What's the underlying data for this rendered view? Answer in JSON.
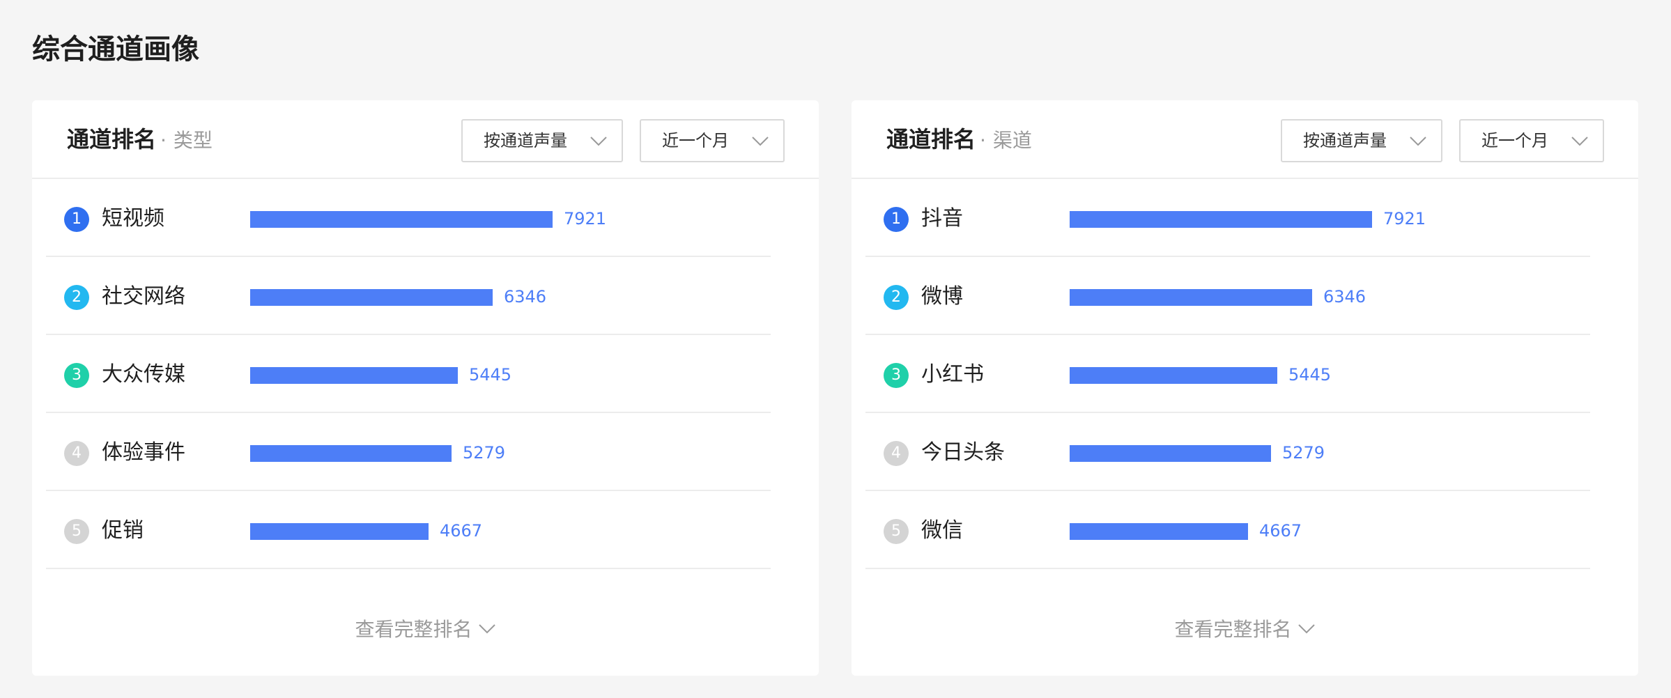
{
  "page_title": "综合通道画像",
  "colors": {
    "bar": "#4d7ef7",
    "rank1": "#2f6ff0",
    "rank2": "#22b8f0",
    "rank3": "#1fd0a9",
    "rank_other": "#d4d4d4"
  },
  "cards": [
    {
      "title": "通道排名",
      "subtitle": "类型",
      "metric_select": "按通道声量",
      "period_select": "近一个月",
      "more_label": "查看完整排名",
      "items": [
        {
          "rank": "1",
          "label": "短视频",
          "value": 7921
        },
        {
          "rank": "2",
          "label": "社交网络",
          "value": 6346
        },
        {
          "rank": "3",
          "label": "大众传媒",
          "value": 5445
        },
        {
          "rank": "4",
          "label": "体验事件",
          "value": 5279
        },
        {
          "rank": "5",
          "label": "促销",
          "value": 4667
        }
      ]
    },
    {
      "title": "通道排名",
      "subtitle": "渠道",
      "metric_select": "按通道声量",
      "period_select": "近一个月",
      "more_label": "查看完整排名",
      "items": [
        {
          "rank": "1",
          "label": "抖音",
          "value": 7921
        },
        {
          "rank": "2",
          "label": "微博",
          "value": 6346
        },
        {
          "rank": "3",
          "label": "小红书",
          "value": 5445
        },
        {
          "rank": "4",
          "label": "今日头条",
          "value": 5279
        },
        {
          "rank": "5",
          "label": "微信",
          "value": 4667
        }
      ]
    }
  ]
}
